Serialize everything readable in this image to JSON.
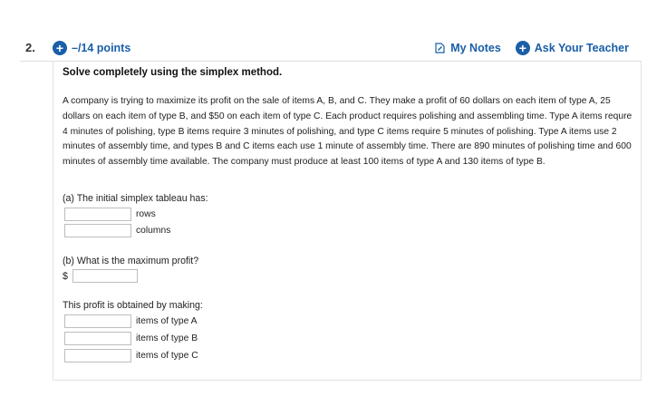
{
  "question": {
    "number": "2.",
    "points": "–/14 points",
    "my_notes": "My Notes",
    "ask_teacher": "Ask Your Teacher",
    "instruction": "Solve completely using the simplex method.",
    "text": "A company is trying to maximize its profit on the sale of items A, B, and C. They make a profit of 60 dollars on each item of type A, 25 dollars on each item of type B, and $50 on each item of type C. Each product requires polishing and assembling time. Type A items requre 4 minutes of polishing, type B items require 3 minutes of polishing, and type C items require 5 minutes of polishing. Type A items use 2 minutes of assembly time, and types B and C items each use 1 minute of assembly time. There are 890 minutes of polishing time and 600 minutes of assembly time available. The company must produce at least 100 items of type A and 130 items of type B."
  },
  "part_a": {
    "prompt": "(a) The initial simplex tableau has:",
    "rows_label": "rows",
    "rows_value": "",
    "columns_label": "columns",
    "columns_value": ""
  },
  "part_b": {
    "prompt": "(b) What is the maximum profit?",
    "currency": "$",
    "profit_value": "",
    "obtained_prompt": "This profit is obtained by making:",
    "type_a_label": "items of type A",
    "type_a_value": "",
    "type_b_label": "items of type B",
    "type_b_value": "",
    "type_c_label": "items of type C",
    "type_c_value": ""
  },
  "colors": {
    "link_blue": "#1a5ea8",
    "border": "#e2e2e2",
    "input_border": "#bdbdbd"
  },
  "icons": {
    "plus": "plus-circle-icon",
    "notes": "notes-icon"
  }
}
